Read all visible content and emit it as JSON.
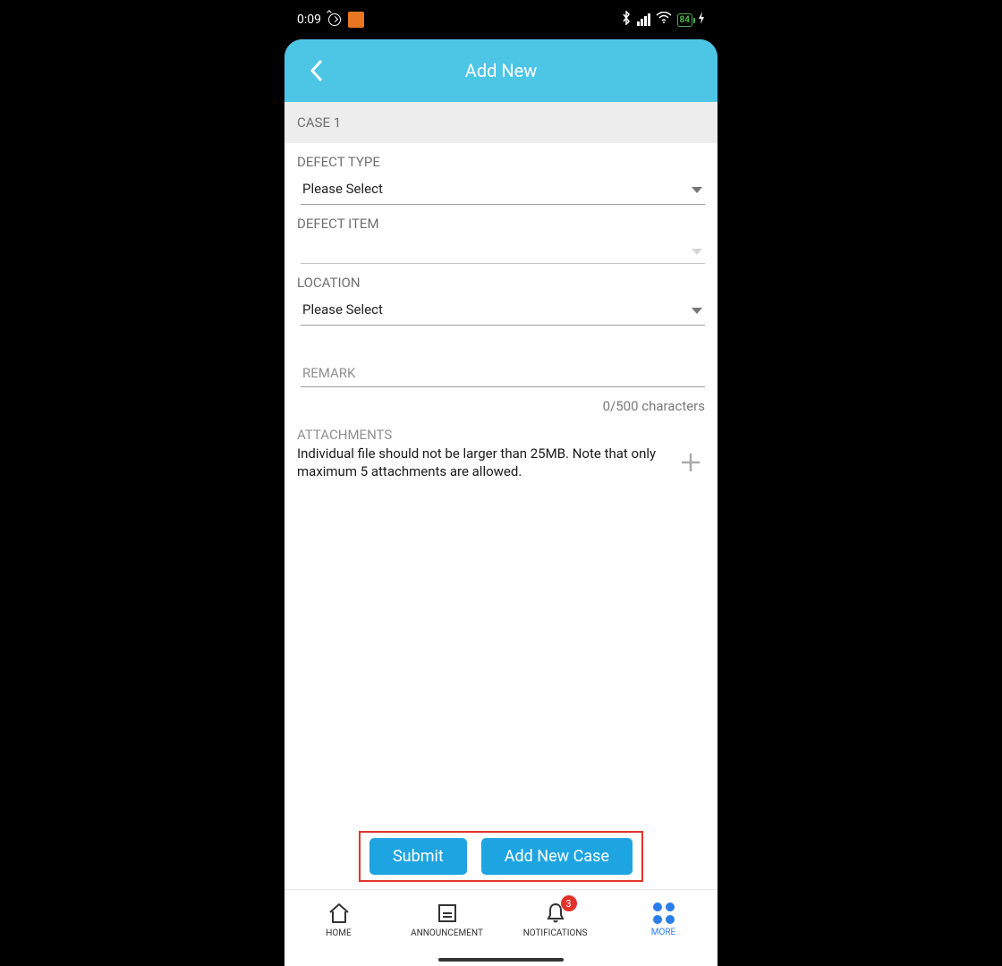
{
  "statusbar": {
    "time": "0:09",
    "battery": "84"
  },
  "header": {
    "title": "Add New"
  },
  "section": {
    "case_label": "CASE 1"
  },
  "form": {
    "defect_type": {
      "label": "DEFECT TYPE",
      "value": "Please Select"
    },
    "defect_item": {
      "label": "DEFECT ITEM",
      "value": ""
    },
    "location": {
      "label": "LOCATION",
      "value": "Please Select"
    },
    "remark": {
      "placeholder": "REMARK",
      "value": "",
      "counter": "0/500 characters"
    },
    "attachments": {
      "label": "ATTACHMENTS",
      "note": "Individual file should not be larger than 25MB. Note that only maximum 5 attachments are allowed."
    }
  },
  "actions": {
    "submit": "Submit",
    "add_new_case": "Add New Case"
  },
  "nav": {
    "home": "HOME",
    "announcement": "ANNOUNCEMENT",
    "notifications": "NOTIFICATIONS",
    "notifications_badge": "3",
    "more": "MORE"
  }
}
